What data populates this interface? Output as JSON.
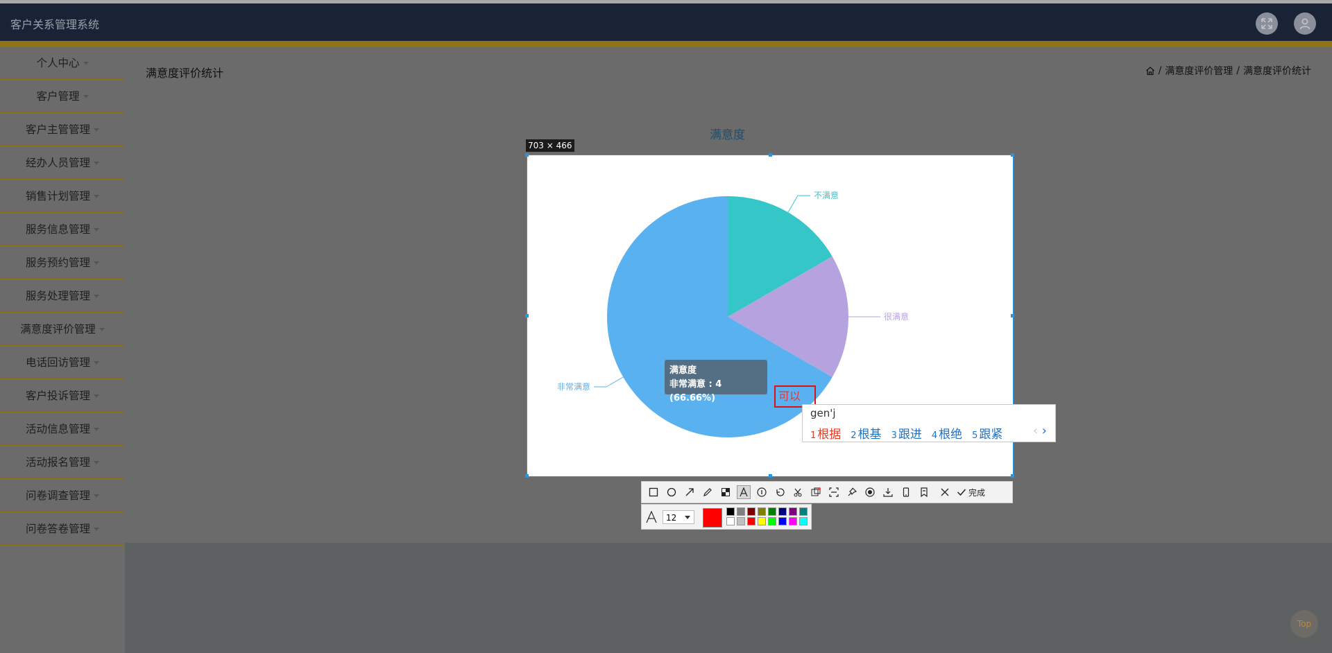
{
  "app": {
    "title": "客户关系管理系统"
  },
  "sidebar": {
    "items": [
      {
        "label": "个人中心"
      },
      {
        "label": "客户管理"
      },
      {
        "label": "客户主管管理"
      },
      {
        "label": "经办人员管理"
      },
      {
        "label": "销售计划管理"
      },
      {
        "label": "服务信息管理"
      },
      {
        "label": "服务预约管理"
      },
      {
        "label": "服务处理管理"
      },
      {
        "label": "满意度评价管理"
      },
      {
        "label": "电话回访管理"
      },
      {
        "label": "客户投诉管理"
      },
      {
        "label": "活动信息管理"
      },
      {
        "label": "活动报名管理"
      },
      {
        "label": "问卷调查管理"
      },
      {
        "label": "问卷答卷管理"
      }
    ]
  },
  "page": {
    "title": "满意度评价统计",
    "breadcrumb": [
      "满意度评价管理",
      "满意度评价统计"
    ],
    "separator": "/"
  },
  "chart_data": {
    "type": "pie",
    "title": "满意度",
    "slices": [
      {
        "name": "不满意",
        "value": 1,
        "color": "#35c6c8"
      },
      {
        "name": "很满意",
        "value": 1,
        "color": "#b6a2de"
      },
      {
        "name": "非常满意",
        "value": 4,
        "color": "#5ab1ef"
      }
    ],
    "tooltip": {
      "series": "满意度",
      "text": "非常满意 : 4 (66.66%)"
    }
  },
  "screenshot_tool": {
    "size_label": "703 × 466",
    "typed_text": "可以",
    "done_label": "完成",
    "font_size": "12",
    "current_color": "#ff0000",
    "palette": [
      "#000000",
      "#808080",
      "#800000",
      "#808000",
      "#008000",
      "#000080",
      "#800080",
      "#008080",
      "#ffffff",
      "#c0c0c0",
      "#ff0000",
      "#ffff00",
      "#00ff00",
      "#0000ff",
      "#ff00ff",
      "#00ffff"
    ]
  },
  "ime": {
    "composition": "gen'j",
    "candidates": [
      {
        "n": "1",
        "text": "根据"
      },
      {
        "n": "2",
        "text": "根基"
      },
      {
        "n": "3",
        "text": "跟进"
      },
      {
        "n": "4",
        "text": "根绝"
      },
      {
        "n": "5",
        "text": "跟紧"
      }
    ],
    "prev": "‹",
    "next": "›"
  },
  "scroll_top": {
    "label": "Top"
  }
}
